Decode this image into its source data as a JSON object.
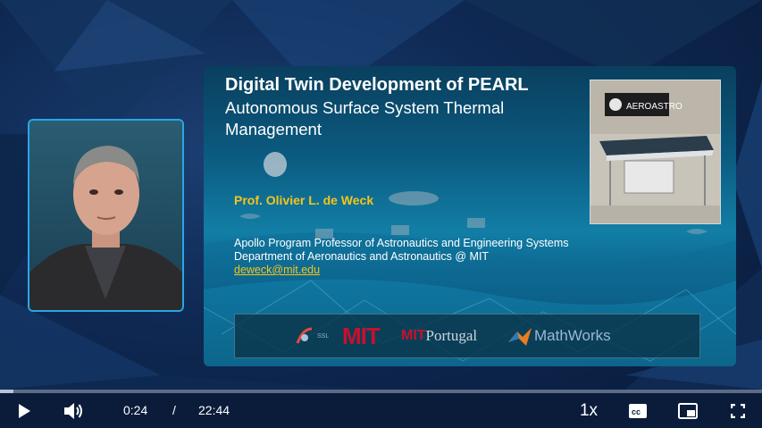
{
  "slide": {
    "title_bold": "Digital Twin Development of PEARL",
    "title_regular": "Autonomous Surface System Thermal Management",
    "presenter": "Prof. Olivier L. de Weck",
    "affiliation_1": "Apollo Program Professor of Astronautics and Engineering Systems",
    "affiliation_2": "Department of Aeronautics and Astronautics @ MIT",
    "email": "deweck@mit.edu",
    "photo_banner": "AEROASTRO",
    "logos": {
      "ssl": "SSL",
      "mit": "MIT",
      "mitportugal_a": "MIT",
      "mitportugal_b": "Portugal",
      "mathworks": "MathWorks"
    }
  },
  "controls": {
    "current_time": "0:24",
    "separator": "/",
    "duration": "22:44",
    "speed": "1x",
    "progress_fraction": 0.018,
    "icons": [
      "play-icon",
      "volume-icon",
      "captions-icon",
      "picture-in-picture-icon",
      "fullscreen-icon"
    ]
  },
  "colors": {
    "accent_border": "#2aa6e6",
    "presenter_name": "#f5c518",
    "control_bar": "#0a1c3a"
  }
}
